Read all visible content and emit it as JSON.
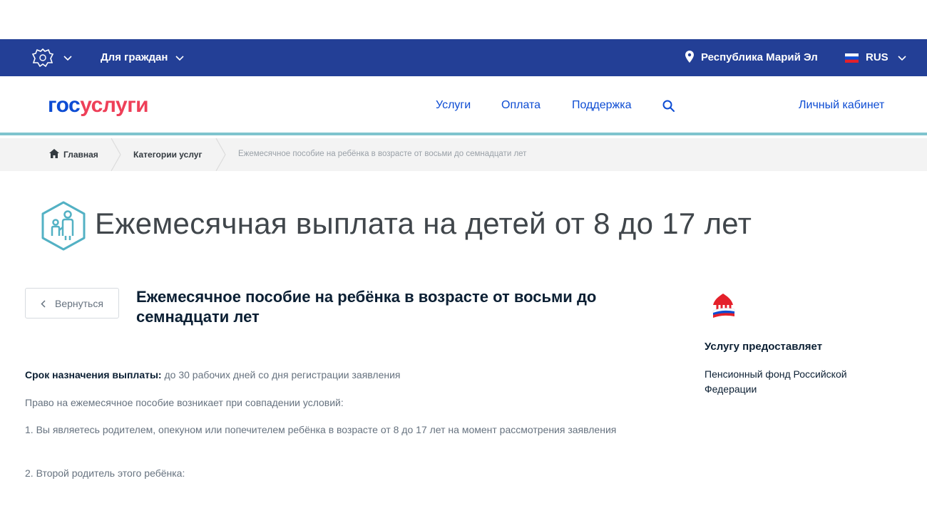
{
  "topbar": {
    "for_citizens": "Для граждан",
    "region": "Республика Марий Эл",
    "language": "RUS"
  },
  "header": {
    "logo_part1": "гос",
    "logo_part2": "услуги",
    "nav": [
      "Услуги",
      "Оплата",
      "Поддержка"
    ],
    "cabinet": "Личный кабинет"
  },
  "breadcrumb": {
    "home": "Главная",
    "categories": "Категории услуг",
    "current": "Ежемесячное пособие на ребёнка в возрасте от восьми до семнадцати лет"
  },
  "page": {
    "title": "Ежемесячная выплата на детей от 8 до 17 лет",
    "back_label": "Вернуться",
    "service_title": "Ежемесячное пособие на ребёнка в возрасте от восьми до семнадцати лет"
  },
  "content": {
    "term_label": "Срок назначения выплаты:",
    "term_value": " до 30 рабочих дней со дня регистрации заявления",
    "conditions_intro": "Право на ежемесячное пособие возникает при совпадении условий:",
    "condition_1": "1. Вы являетесь родителем, опекуном или попечителем ребёнка в возрасте от 8 до 17 лет на момент рассмотрения заявления",
    "condition_2": "2. Второй родитель этого ребёнка:"
  },
  "provider": {
    "heading": "Услугу предоставляет",
    "name": "Пенсионный фонд Российской Федерации"
  },
  "colors": {
    "topbar": "#233f96",
    "link": "#0d4cd3",
    "logo_red": "#ee3f58",
    "accent_teal": "#7fc4ce"
  }
}
